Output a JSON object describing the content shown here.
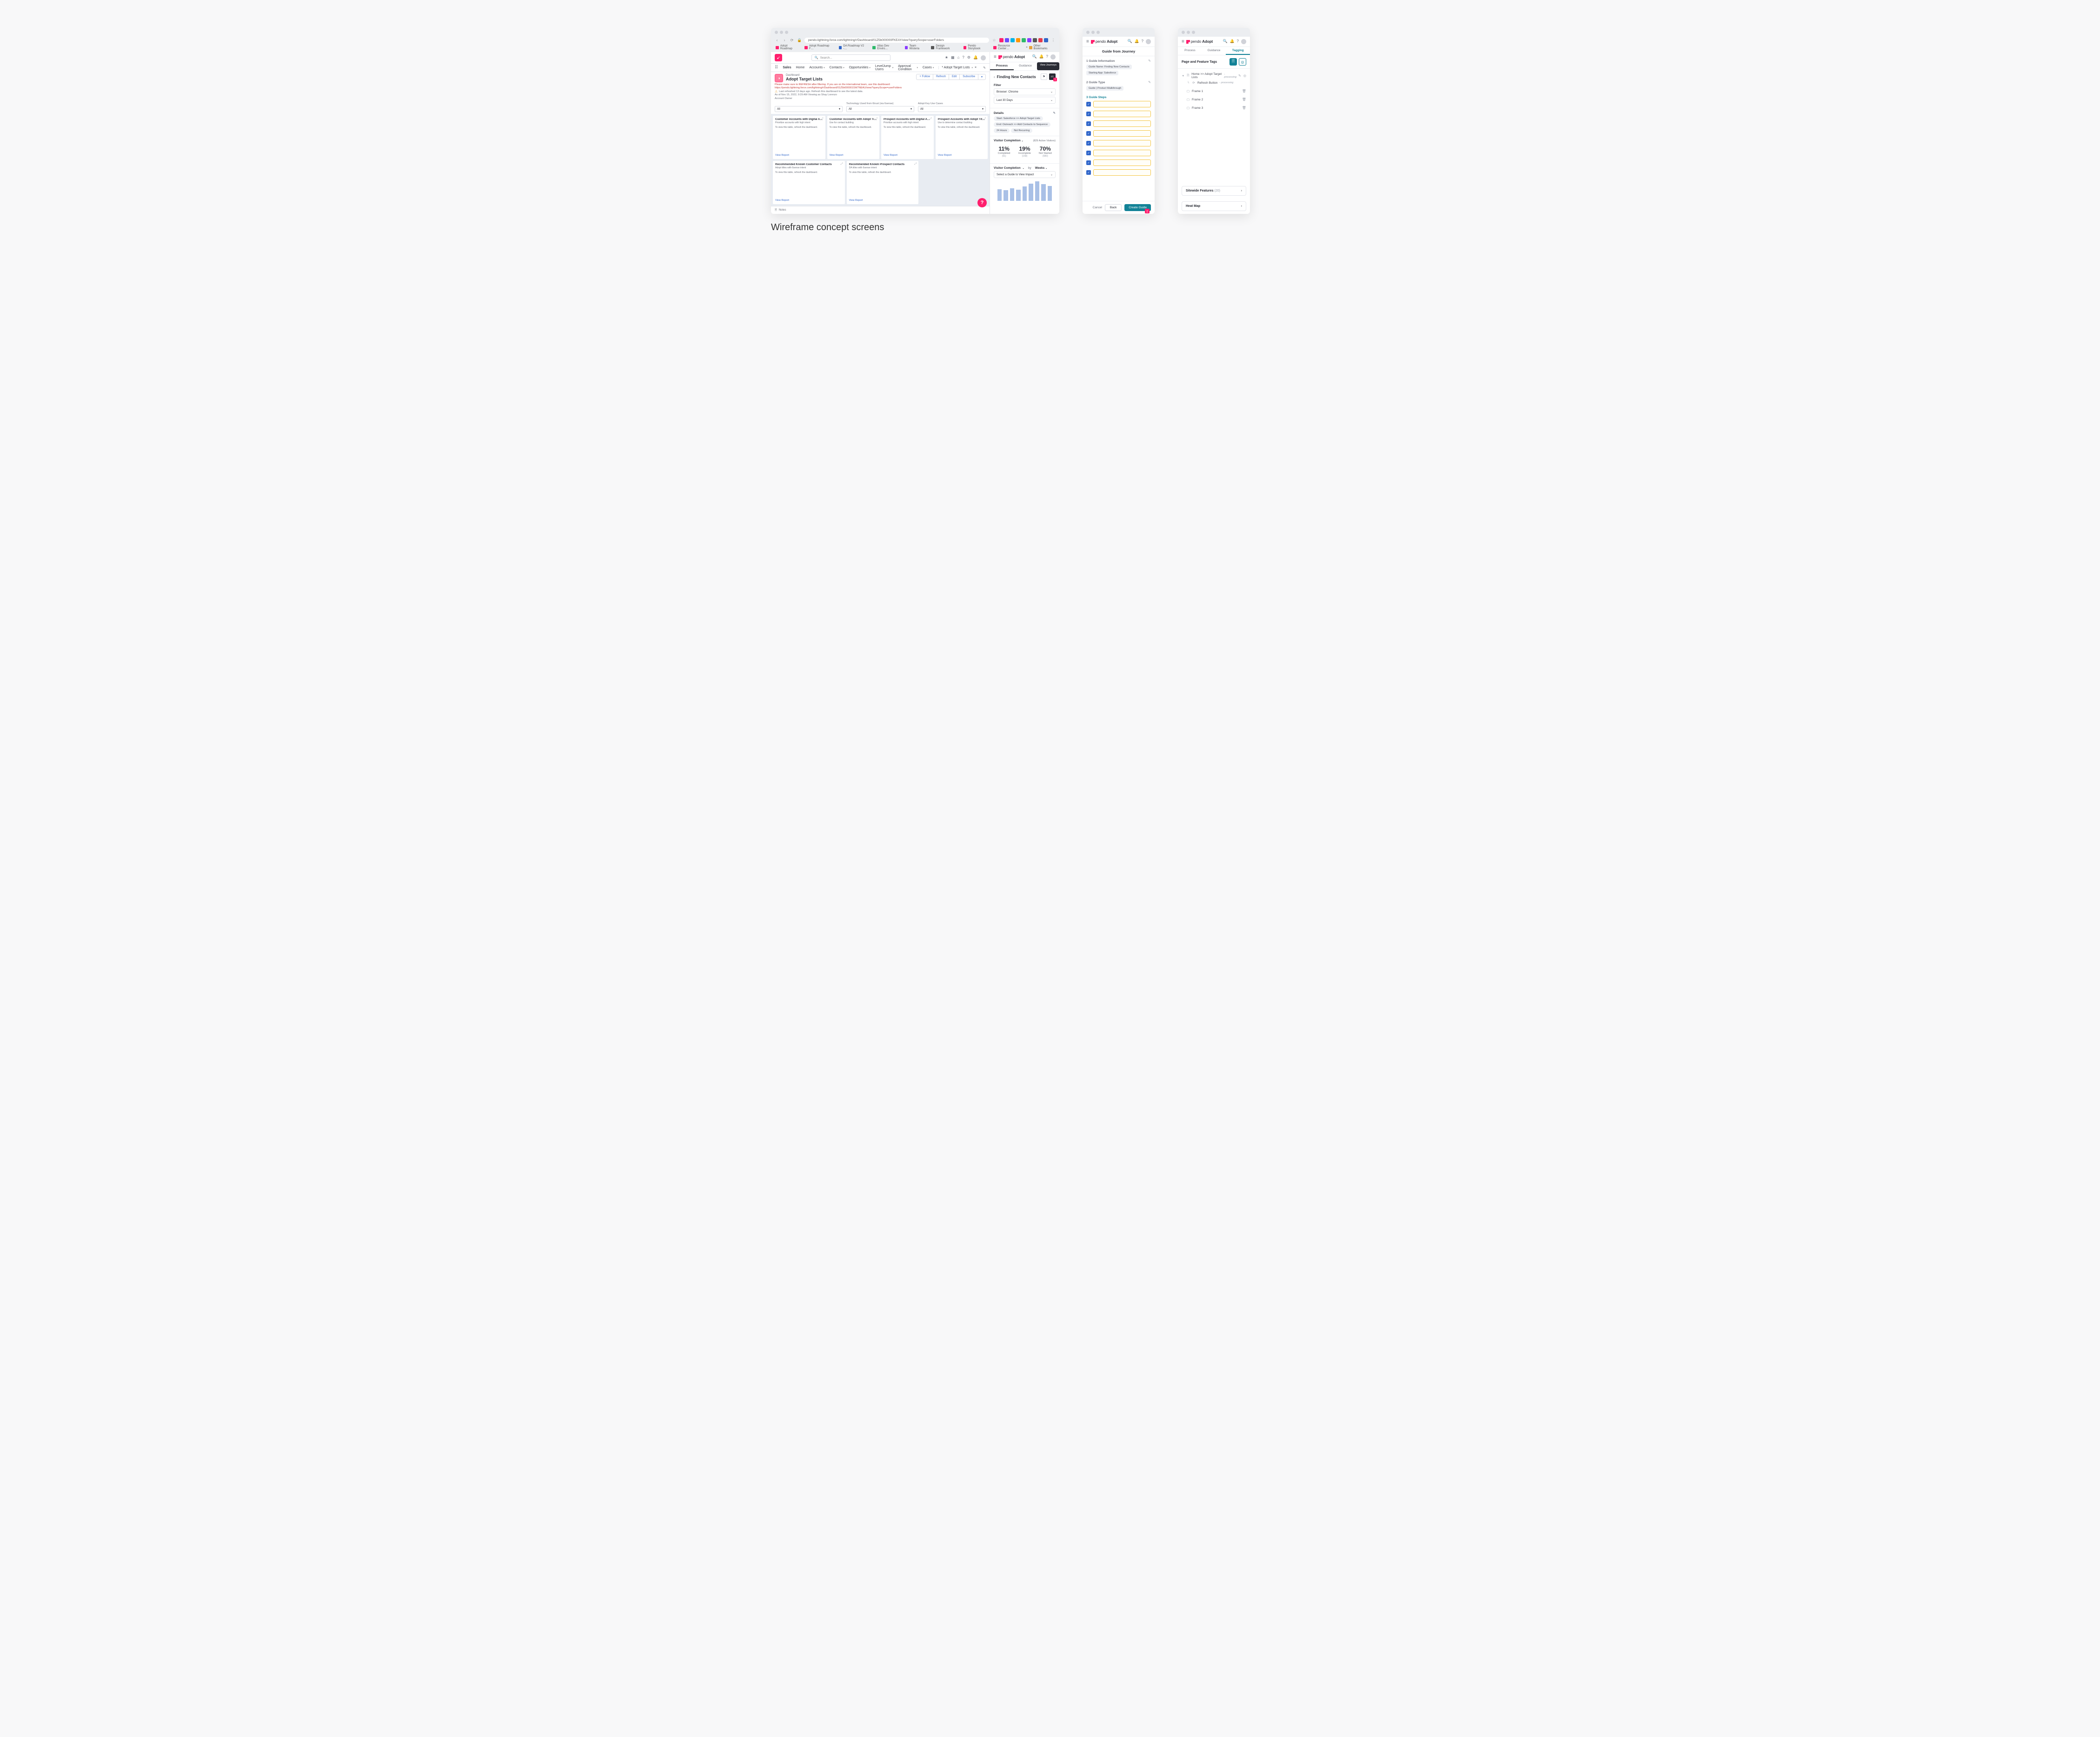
{
  "caption": "Wireframe concept screens",
  "chrome": {
    "url": "pendo.lightning.force.com/lightning/r/Dashboard/01Z5b000000FKEAY/view?queryScope=userFolders",
    "bookmarks": [
      "Adopt Roadmap",
      "Adopt Roadmap F…",
      "DA Roadmap V2 -…",
      "Atlas Dev Enviro…",
      "Team Wisteria",
      "Design Framework",
      "Pendo Storybook",
      "Resource Center…"
    ],
    "other_bookmarks": "Other Bookmarks"
  },
  "sf": {
    "search_placeholder": "Search...",
    "app": "Sales",
    "nav": [
      "Home",
      "Accounts",
      "Contacts",
      "Opportunities",
      "LevelJump Users",
      "Approval Condition",
      "Cases"
    ],
    "tab": "* Adopt Target Lists",
    "dash_label": "Dashboard",
    "dash_name": "Adopt Target Lists",
    "actions": [
      "+ Follow",
      "Refresh",
      "Edit",
      "Subscribe",
      "▾"
    ],
    "red_note": "Please make sure to REFRESH after filtering. If you are on the international team, use this dashboard: https://pendo.lightning.force.com/lightning/r/Dashboard/01Z5b000001SW7NEAU/view?queryScope=userFolders",
    "warn": "Last refreshed 13 days ago. Refresh this dashboard to see the latest data.",
    "asof": "As of Nov 15, 2022, 9:29 AM·Viewing as Shay Lorenzo",
    "owner_label": "Account Owner",
    "filters": [
      {
        "label": "",
        "value": "All"
      },
      {
        "label": "Technology Used from 6trust (via 6sense)",
        "value": "All"
      },
      {
        "label": "Adopt Key Use Cases",
        "value": "All"
      }
    ],
    "tiles_row1": [
      {
        "h": "Customer Accounts with Digital Ado…",
        "sub": "Prioritize accounts with high intent",
        "body": "To view this table, refresh the dashboard."
      },
      {
        "h": "Customer Accounts with Adopt Titles",
        "sub": "Use for contact building",
        "body": "To view this table, refresh the dashboard."
      },
      {
        "h": "Prospect Accounts with Digital Adopt…",
        "sub": "Prioritize accounts with high intent",
        "body": "To view this table, refresh the dashboard."
      },
      {
        "h": "Prospect Accounts with Adopt Titles",
        "sub": "Use to determine contact building",
        "body": "To view this table, refresh the dashboard."
      }
    ],
    "tiles_row2": [
      {
        "h": "Recommended Known Customer Contacts",
        "sub": "Adopt titles with 6sense intent",
        "body": "To view this table, refresh the dashboard."
      },
      {
        "h": "Recommended Known Prospect Contacts",
        "sub": "DA titles with 6sense intent",
        "body": "To view this table, refresh the dashboard."
      }
    ],
    "view_report": "View Report",
    "notes": "Notes"
  },
  "pendo": {
    "brand_a": "pendo",
    "brand_b": "Adopt",
    "tabs": {
      "process": "Process",
      "guidance": "Guidance",
      "tagging": "Tagging"
    },
    "view_journeys": "View Journeys",
    "back": "‹",
    "title": "Finding New Contacts",
    "filter_h": "Filter",
    "filters": [
      {
        "label": "Browser: Chrome",
        "caret": "⌄"
      },
      {
        "label": "Last 30 Days",
        "caret": "⌄"
      }
    ],
    "details_h": "Details",
    "details_pills": [
      "Start: Salesforce >> Adopt Target Lists",
      "End: Outreach >> Add Contacts to Sequence",
      "24 Hours",
      "Not Recurring"
    ],
    "vc_h": "Visitor Completion",
    "vc_sub": "(829 Active Visitors)",
    "stats": [
      {
        "n": "11%",
        "l": "Completed",
        "p": "(91)"
      },
      {
        "n": "19%",
        "l": "Incomplete",
        "p": "(158)"
      },
      {
        "n": "70%",
        "l": "Not Started",
        "p": "(580)"
      }
    ],
    "vc2_h": "Visitor Completion",
    "vc2_by": "by",
    "vc2_weeks": "Weeks",
    "select_guide": "Select a Guide to View Impact",
    "bars": [
      42,
      38,
      45,
      40,
      52,
      62,
      70,
      60,
      54
    ]
  },
  "journey": {
    "title": "Guide from Journey",
    "s1_h": "1 Guide Information",
    "s1_chips": [
      "Guide Name: Finding New Contacts",
      "Starting App: Salesforce"
    ],
    "s2_h": "2 Guide Type",
    "s2_chips": [
      "Guide | Product Walkthrough"
    ],
    "s3_h": "3 Guide Steps",
    "step_count": 8,
    "cancel": "Cancel",
    "back": "Back",
    "create": "Create Guide"
  },
  "tagging": {
    "pf_title": "Page and Feature Tags",
    "root": "Home >> Adopt Target Lists",
    "root_status": "- processing",
    "child": "Refresh Button",
    "child_status": "- processing",
    "frames": [
      "Frame 1",
      "Frame 2",
      "Frame 3"
    ],
    "sitewide": "Sitewide Features",
    "sitewide_count": "(20)",
    "heatmap": "Heat Map"
  }
}
